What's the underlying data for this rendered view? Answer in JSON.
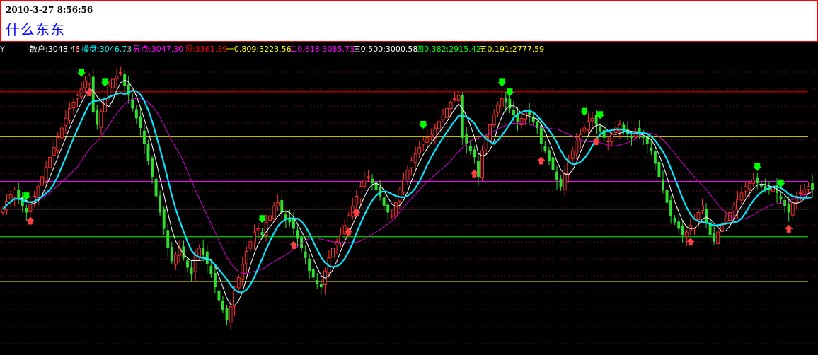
{
  "header": {
    "datetime": "2010-3-27 8:56:56",
    "title": "什么东东"
  },
  "chart_data": {
    "type": "candlestick",
    "y_label": "Y",
    "ylim": [
      2560,
      3470
    ],
    "legend": [
      {
        "label": "散户:3048.45",
        "color": "#ffffff",
        "arrow": "↑"
      },
      {
        "label": "操盘:3046.73",
        "color": "#00ffff",
        "arrow": "↑"
      },
      {
        "label": "界点:3047.30",
        "color": "#ff00ff",
        "arrow": "↑"
      },
      {
        "label": "顶:3361.39",
        "color": "#ff0000",
        "arrow": ""
      },
      {
        "label": "一0.809:3223.56",
        "color": "#ffff00",
        "arrow": ""
      },
      {
        "label": "二0.618:3085.73",
        "color": "#ff00ff",
        "arrow": ""
      },
      {
        "label": "三0.500:3000.58",
        "color": "#ffffff",
        "arrow": ""
      },
      {
        "label": "四0.382:2915.42",
        "color": "#00ff00",
        "arrow": ""
      },
      {
        "label": "五0.191:2777.59",
        "color": "#ffff00",
        "arrow": ""
      }
    ],
    "levels": [
      {
        "name": "顶",
        "value": 3361.39,
        "color": "#ff0000"
      },
      {
        "name": "一",
        "value": 3223.56,
        "color": "#ffff00"
      },
      {
        "name": "二",
        "value": 3085.73,
        "color": "#ff00ff"
      },
      {
        "name": "三",
        "value": 3000.58,
        "color": "#ffffff"
      },
      {
        "name": "四",
        "value": 2915.42,
        "color": "#00ff00"
      },
      {
        "name": "五",
        "value": 2777.59,
        "color": "#ffff00"
      }
    ],
    "close": [
      3000,
      3025,
      3045,
      3060,
      3030,
      3010,
      2990,
      3015,
      3040,
      3070,
      3100,
      3130,
      3160,
      3190,
      3220,
      3250,
      3280,
      3310,
      3330,
      3350,
      3370,
      3395,
      3410,
      3300,
      3260,
      3300,
      3340,
      3380,
      3400,
      3410,
      3420,
      3380,
      3350,
      3310,
      3280,
      3250,
      3200,
      3150,
      3100,
      3040,
      2990,
      2940,
      2880,
      2840,
      2860,
      2880,
      2850,
      2820,
      2800,
      2860,
      2880,
      2860,
      2830,
      2800,
      2760,
      2720,
      2690,
      2660,
      2700,
      2750,
      2790,
      2830,
      2870,
      2900,
      2930,
      2940,
      2920,
      2960,
      2980,
      3010,
      3020,
      2990,
      2970,
      2960,
      2940,
      2910,
      2880,
      2850,
      2810,
      2790,
      2770,
      2760,
      2810,
      2850,
      2880,
      2900,
      2920,
      2950,
      2980,
      3010,
      3040,
      3070,
      3090,
      3100,
      3080,
      3060,
      3040,
      3010,
      2990,
      2980,
      3020,
      3060,
      3090,
      3120,
      3150,
      3170,
      3190,
      3210,
      3220,
      3230,
      3250,
      3270,
      3290,
      3310,
      3330,
      3340,
      3350,
      3220,
      3200,
      3180,
      3160,
      3100,
      3180,
      3220,
      3260,
      3290,
      3320,
      3340,
      3330,
      3310,
      3290,
      3270,
      3280,
      3300,
      3290,
      3270,
      3250,
      3200,
      3180,
      3150,
      3120,
      3090,
      3070,
      3110,
      3150,
      3180,
      3210,
      3230,
      3250,
      3270,
      3280,
      3260,
      3240,
      3220,
      3210,
      3230,
      3250,
      3260,
      3240,
      3230,
      3220,
      3240,
      3230,
      3220,
      3200,
      3180,
      3140,
      3100,
      3060,
      3020,
      2980,
      2960,
      2940,
      2920,
      2930,
      2950,
      2970,
      2990,
      3010,
      2960,
      2920,
      2900,
      2930,
      2950,
      2970,
      2990,
      3010,
      3030,
      3050,
      3070,
      3080,
      3090,
      3080,
      3070,
      3060,
      3060,
      3070,
      3050,
      3030,
      3010,
      2990,
      3020,
      3040,
      3050,
      3060,
      3070,
      3060
    ],
    "signals": [
      {
        "index": 6,
        "type": "sell"
      },
      {
        "index": 7,
        "type": "buy"
      },
      {
        "index": 20,
        "type": "sell"
      },
      {
        "index": 22,
        "type": "buy"
      },
      {
        "index": 26,
        "type": "sell"
      },
      {
        "index": 66,
        "type": "sell"
      },
      {
        "index": 74,
        "type": "buy"
      },
      {
        "index": 88,
        "type": "buy"
      },
      {
        "index": 90,
        "type": "buy"
      },
      {
        "index": 107,
        "type": "sell"
      },
      {
        "index": 120,
        "type": "buy"
      },
      {
        "index": 127,
        "type": "sell"
      },
      {
        "index": 129,
        "type": "sell"
      },
      {
        "index": 137,
        "type": "buy"
      },
      {
        "index": 148,
        "type": "sell"
      },
      {
        "index": 151,
        "type": "buy"
      },
      {
        "index": 152,
        "type": "sell"
      },
      {
        "index": 175,
        "type": "buy"
      },
      {
        "index": 192,
        "type": "sell"
      },
      {
        "index": 198,
        "type": "sell"
      },
      {
        "index": 200,
        "type": "buy"
      }
    ]
  }
}
